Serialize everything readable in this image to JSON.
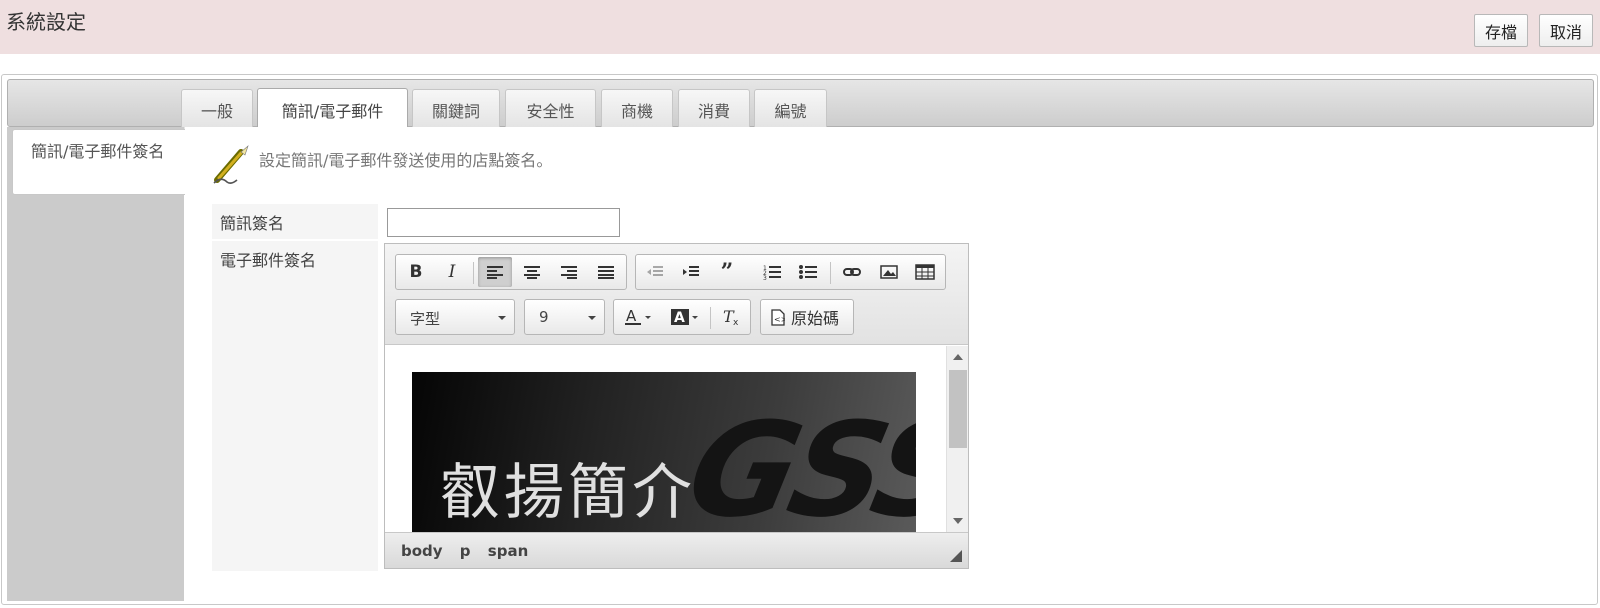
{
  "header": {
    "title": "系統設定",
    "save_label": "存檔",
    "cancel_label": "取消"
  },
  "tabs": [
    {
      "label": "一般",
      "active": false
    },
    {
      "label": "簡訊/電子郵件",
      "active": true
    },
    {
      "label": "關鍵詞",
      "active": false
    },
    {
      "label": "安全性",
      "active": false
    },
    {
      "label": "商機",
      "active": false
    },
    {
      "label": "消費",
      "active": false
    },
    {
      "label": "編號",
      "active": false
    }
  ],
  "sidebar": {
    "items": [
      {
        "label": "簡訊/電子郵件簽名",
        "active": true
      }
    ]
  },
  "content": {
    "description": "設定簡訊/電子郵件發送使用的店點簽名。",
    "sms_label": "簡訊簽名",
    "sms_value": "",
    "email_label": "電子郵件簽名"
  },
  "editor": {
    "font_combo": "字型",
    "size_combo": "9",
    "source_label": "原始碼",
    "banner_text": "叡揚簡介",
    "banner_logo": "GSS",
    "path": [
      "body",
      "p",
      "span"
    ],
    "active_align": "align-left"
  },
  "colors": {
    "header_bg": "#efdfe0",
    "sidebar_bg": "#cbcbcb",
    "label_bg": "#f5f5f5"
  }
}
